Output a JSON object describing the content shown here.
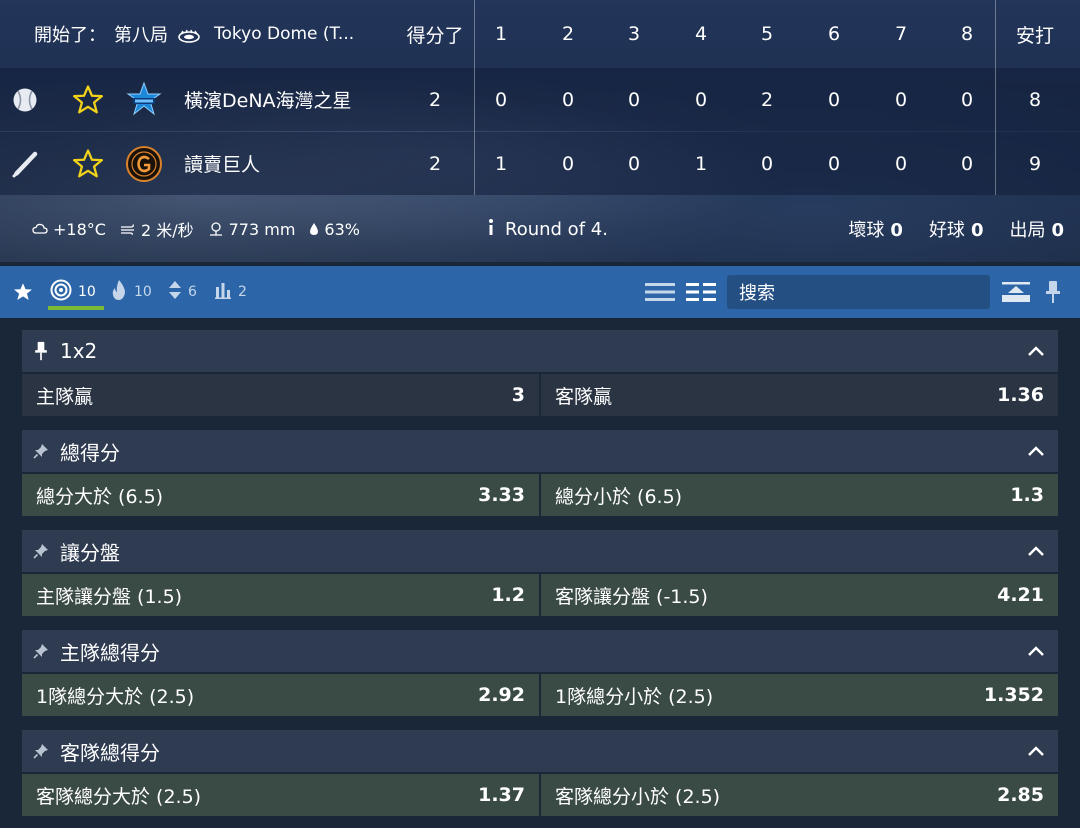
{
  "header": {
    "status": "開始了：",
    "period": "第八局",
    "venue": "Tokyo Dome (T...",
    "score_label": "得分了",
    "innings": [
      "1",
      "2",
      "3",
      "4",
      "5",
      "6",
      "7",
      "8"
    ],
    "hits_label": "安打"
  },
  "teams": [
    {
      "name": "橫濱DeNA海灣之星",
      "score": "2",
      "innings": [
        "0",
        "0",
        "0",
        "0",
        "2",
        "0",
        "0",
        "0"
      ],
      "hits": "8",
      "role_icon": "baseball-icon"
    },
    {
      "name": "讀賣巨人",
      "score": "2",
      "innings": [
        "1",
        "0",
        "0",
        "1",
        "0",
        "0",
        "0",
        "0"
      ],
      "hits": "9",
      "role_icon": "bat-icon"
    }
  ],
  "weather": {
    "temp": "+18°C",
    "wind": "2 米/秒",
    "pressure": "773 mm",
    "humidity": "63%"
  },
  "round": "Round of 4.",
  "counts": [
    {
      "label": "壞球",
      "value": "0"
    },
    {
      "label": "好球",
      "value": "0"
    },
    {
      "label": "出局",
      "value": "0"
    }
  ],
  "toolbar": {
    "tabs": [
      {
        "icon": "target-icon",
        "count": "10"
      },
      {
        "icon": "flame-icon",
        "count": "10"
      },
      {
        "icon": "sort-icon",
        "count": "6"
      },
      {
        "icon": "stats-icon",
        "count": "2"
      }
    ],
    "search_label": "搜索"
  },
  "markets": [
    {
      "title": "1x2",
      "pinned": true,
      "options": [
        {
          "label": "主隊贏",
          "value": "3"
        },
        {
          "label": "客隊贏",
          "value": "1.36"
        }
      ],
      "style": "plain"
    },
    {
      "title": "總得分",
      "pinned": false,
      "options": [
        {
          "label": "總分大於 (6.5)",
          "value": "3.33"
        },
        {
          "label": "總分小於 (6.5)",
          "value": "1.3"
        }
      ],
      "style": "green"
    },
    {
      "title": "讓分盤",
      "pinned": false,
      "options": [
        {
          "label": "主隊讓分盤 (1.5)",
          "value": "1.2"
        },
        {
          "label": "客隊讓分盤 (-1.5)",
          "value": "4.21"
        }
      ],
      "style": "green"
    },
    {
      "title": "主隊總得分",
      "pinned": false,
      "options": [
        {
          "label": "1隊總分大於 (2.5)",
          "value": "2.92"
        },
        {
          "label": "1隊總分小於 (2.5)",
          "value": "1.352"
        }
      ],
      "style": "green"
    },
    {
      "title": "客隊總得分",
      "pinned": false,
      "options": [
        {
          "label": "客隊總分大於 (2.5)",
          "value": "1.37"
        },
        {
          "label": "客隊總分小於 (2.5)",
          "value": "2.85"
        }
      ],
      "style": "green"
    }
  ],
  "colors": {
    "toolbar": "#2c66a8",
    "accent_green": "#7dbb35",
    "star": "#f2d31a",
    "option_green": "#3a4a44"
  }
}
